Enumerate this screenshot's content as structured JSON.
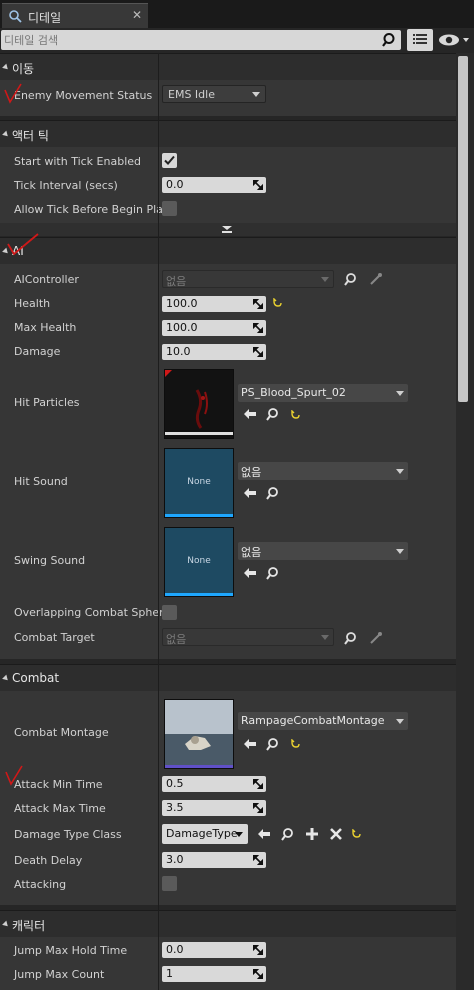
{
  "tab": {
    "title": "디테일"
  },
  "search": {
    "placeholder": "디테일 검색"
  },
  "sections": {
    "movement": "이동",
    "actor_tick": "액터 틱",
    "ai": "AI",
    "combat": "Combat",
    "character": "캐릭터"
  },
  "movement": {
    "enemy_movement_status_label": "Enemy Movement Status",
    "enemy_movement_status_value": "EMS Idle"
  },
  "actor_tick": {
    "start_with_tick_label": "Start with Tick Enabled",
    "start_with_tick_checked": true,
    "tick_interval_label": "Tick Interval (secs)",
    "tick_interval_value": "0.0",
    "allow_tick_label": "Allow Tick Before Begin Play",
    "allow_tick_checked": false
  },
  "ai": {
    "aicontroller_label": "AIController",
    "aicontroller_value": "없음",
    "health_label": "Health",
    "health_value": "100.0",
    "max_health_label": "Max Health",
    "max_health_value": "100.0",
    "damage_label": "Damage",
    "damage_value": "10.0",
    "hit_particles_label": "Hit Particles",
    "hit_particles_value": "PS_Blood_Spurt_02",
    "hit_sound_label": "Hit Sound",
    "hit_sound_thumb": "None",
    "hit_sound_value": "없음",
    "swing_sound_label": "Swing Sound",
    "swing_sound_thumb": "None",
    "swing_sound_value": "없음",
    "overlapping_sphere_label": "Overlapping Combat Sphere",
    "overlapping_sphere_checked": false,
    "combat_target_label": "Combat Target",
    "combat_target_value": "없음"
  },
  "combat": {
    "combat_montage_label": "Combat Montage",
    "combat_montage_value": "RampageCombatMontage",
    "attack_min_label": "Attack Min Time",
    "attack_min_value": "0.5",
    "attack_max_label": "Attack Max Time",
    "attack_max_value": "3.5",
    "damage_type_label": "Damage Type Class",
    "damage_type_value": "DamageType",
    "death_delay_label": "Death Delay",
    "death_delay_value": "3.0",
    "attacking_label": "Attacking",
    "attacking_checked": false
  },
  "character": {
    "jump_hold_label": "Jump Max Hold Time",
    "jump_hold_value": "0.0",
    "jump_count_label": "Jump Max Count",
    "jump_count_value": "1"
  },
  "colors": {
    "panel_bg": "#363636",
    "section_bg": "#2d2d2d",
    "field_bg": "#d9d9d9",
    "annotation_red": "#d01818",
    "reset_yellow": "#e8d030"
  }
}
